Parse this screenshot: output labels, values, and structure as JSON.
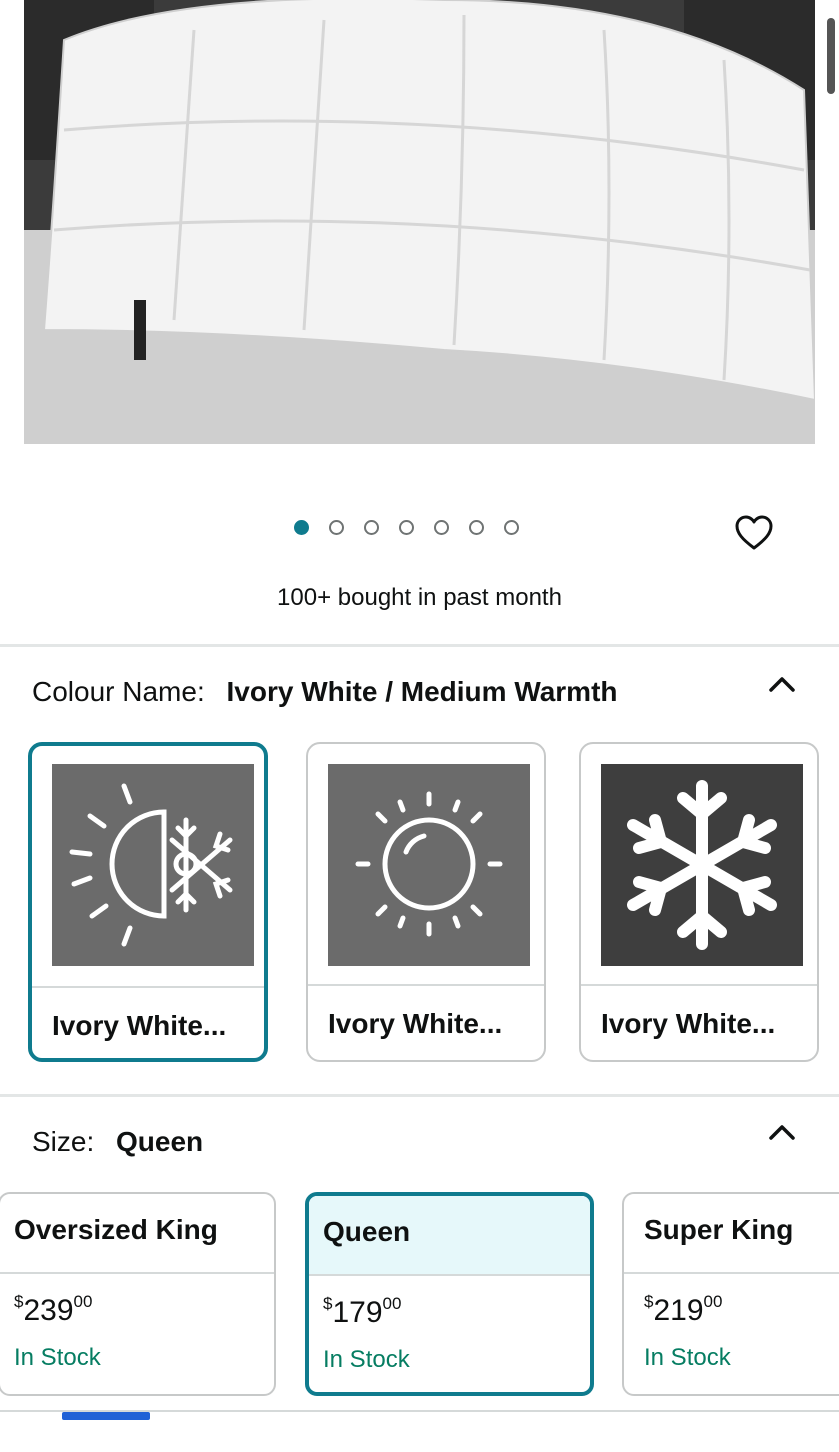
{
  "product": {
    "image_alt": "",
    "gallery": {
      "total_images": 7,
      "active_index": 0,
      "active_color": "#0f7b8e"
    },
    "bought_text": "100+ bought in past month"
  },
  "colour": {
    "key_label": "Colour Name:",
    "selected_value": "Ivory White / Medium Warmth",
    "options": [
      {
        "label": "Ivory White...",
        "icon": "sun-snowflake-icon",
        "selected": true
      },
      {
        "label": "Ivory White...",
        "icon": "sun-icon",
        "selected": false
      },
      {
        "label": "Ivory White...",
        "icon": "snowflake-icon",
        "selected": false
      }
    ]
  },
  "size": {
    "key_label": "Size:",
    "selected_value": "Queen",
    "options": [
      {
        "name": "Oversized King",
        "price_symbol": "$",
        "price_whole": "239",
        "price_fraction": "00",
        "stock": "In Stock",
        "selected": false
      },
      {
        "name": "Queen",
        "price_symbol": "$",
        "price_whole": "179",
        "price_fraction": "00",
        "stock": "In Stock",
        "selected": true
      },
      {
        "name": "Super King",
        "price_symbol": "$",
        "price_whole": "219",
        "price_fraction": "00",
        "stock": "In Stock",
        "selected": false
      }
    ]
  },
  "colors": {
    "accent": "#0f7b8e",
    "in_stock": "#067d62",
    "selected_bg": "#e6f8fa"
  }
}
